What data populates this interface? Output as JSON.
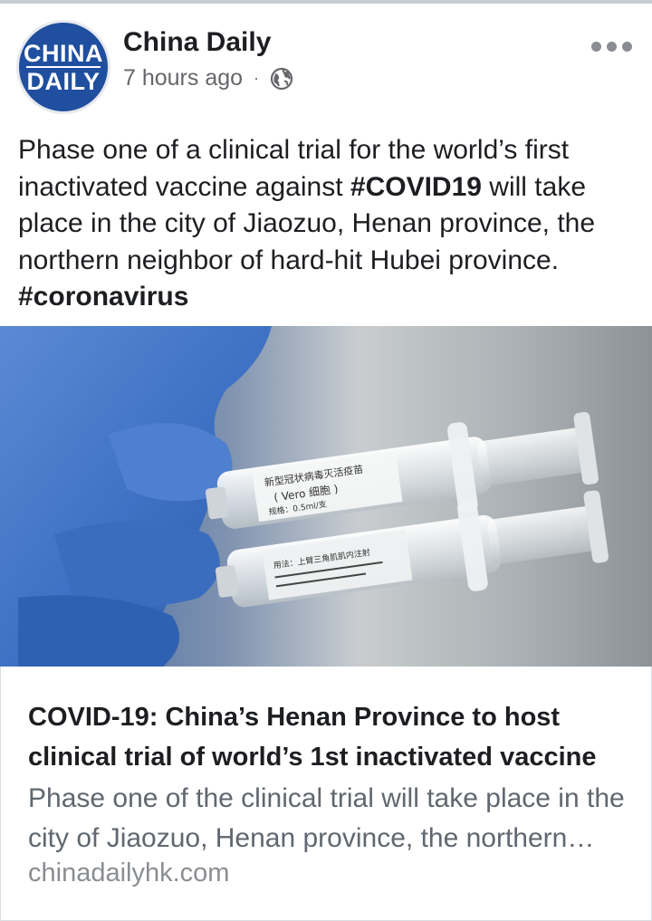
{
  "header": {
    "page_name": "China Daily",
    "timestamp": "7 hours ago",
    "separator": "·",
    "privacy_icon": "globe-icon",
    "menu_icon": "more-options-icon"
  },
  "avatar": {
    "line1": "CHINA",
    "line2": "DAILY",
    "color": "#1f4f9e"
  },
  "post": {
    "text_part1": "Phase one of a clinical trial for the world’s first inactivated vaccine against ",
    "hashtag1": "#COVID19",
    "text_part2": " will take place in the city of Jiaozuo, Henan province, the northern neighbor of hard-hit Hubei province. ",
    "hashtag2": "#coronavirus"
  },
  "photo": {
    "label_line1": "新型冠状病毒灭活疫苗",
    "label_line2": "( Vero 细胞 )",
    "label_line3": "规格：0.5ml/支",
    "label_line4": "用法：上臂三角肌肌内注射"
  },
  "link_preview": {
    "title": "COVID-19: China’s Henan Province to host clinical trial of world’s 1st inactivated vaccine",
    "description": "Phase one of the clinical trial will take place in the city of Jiaozuo, Henan province, the northern neighbor of hard-hit Hubei province.",
    "domain": "chinadailyhk.com"
  }
}
